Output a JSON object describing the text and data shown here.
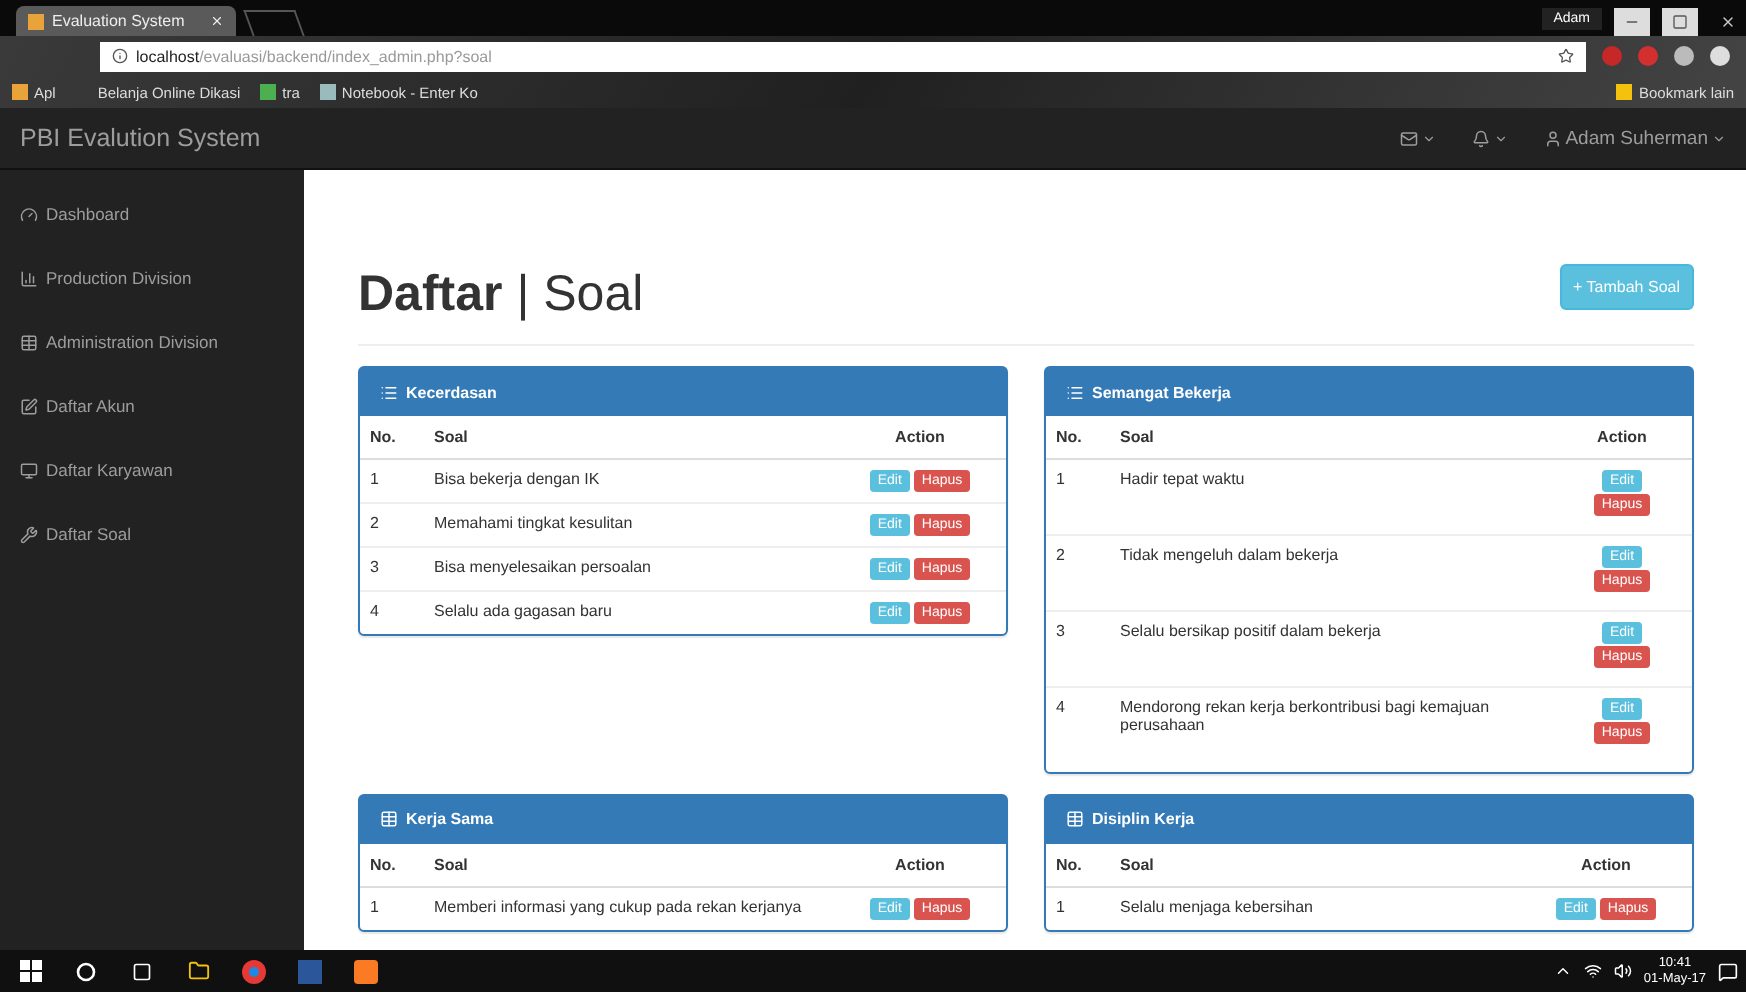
{
  "browser": {
    "tab_title": "Evaluation System",
    "url_host": "localhost",
    "url_path": "/evaluasi/backend/index_admin.php?soal",
    "bookmarks": [
      {
        "label": "Apl"
      },
      {
        "label": "Belanja Online Dikasi"
      },
      {
        "label": "tra"
      },
      {
        "label": "Notebook - Enter Ko"
      }
    ],
    "bookmark_folder": "Bookmark lain",
    "profile": "Adam"
  },
  "navbar": {
    "brand": "PBI Evalution System",
    "user": "Adam Suherman"
  },
  "sidebar": {
    "items": [
      {
        "label": "Dashboard"
      },
      {
        "label": "Production Division"
      },
      {
        "label": "Administration Division"
      },
      {
        "label": "Daftar Akun"
      },
      {
        "label": "Daftar Karyawan"
      },
      {
        "label": "Daftar Soal"
      }
    ]
  },
  "heading": "**Daftar** | Soal",
  "add_button": "+ Tambah Soal",
  "panels": [
    {
      "title": "Kecerdasan",
      "kind": "inline",
      "columns": [
        "No.",
        "Soal",
        "Action"
      ],
      "rows": [
        {
          "no": "1",
          "soal": "Bisa bekerja dengan IK",
          "edit": "Edit",
          "delete": "Hapus"
        },
        {
          "no": "2",
          "soal": "Memahami tingkat kesulitan",
          "edit": "Edit",
          "delete": "Hapus"
        },
        {
          "no": "3",
          "soal": "Bisa menyelesaikan persoalan",
          "edit": "Edit",
          "delete": "Hapus"
        },
        {
          "no": "4",
          "soal": "Selalu ada gagasan baru",
          "edit": "Edit",
          "delete": "Hapus"
        }
      ]
    },
    {
      "title": "Semangat Bekerja",
      "kind": "stacked",
      "columns": [
        "No.",
        "Soal",
        "Action"
      ],
      "rows": [
        {
          "no": "1",
          "soal": "Hadir tepat waktu",
          "edit": "Edit",
          "delete": "Hapus"
        },
        {
          "no": "2",
          "soal": "Tidak mengeluh dalam bekerja",
          "edit": "Edit",
          "delete": "Hapus"
        },
        {
          "no": "3",
          "soal": "Selalu bersikap positif dalam bekerja",
          "edit": "Edit",
          "delete": "Hapus"
        },
        {
          "no": "4",
          "soal": "Mendorong rekan kerja berkontribusi bagi kemajuan perusahaan",
          "edit": "Edit",
          "delete": "Hapus"
        }
      ]
    },
    {
      "title": "Kerja Sama",
      "kind": "inline",
      "columns": [
        "No.",
        "Soal",
        "Action"
      ],
      "rows": [
        {
          "no": "1",
          "soal": "Memberi informasi yang cukup pada rekan kerjanya",
          "edit": "Edit",
          "delete": "Hapus"
        }
      ]
    },
    {
      "title": "Disiplin Kerja",
      "kind": "inline",
      "columns": [
        "No.",
        "Soal",
        "Action"
      ],
      "rows": [
        {
          "no": "1",
          "soal": "Selalu menjaga kebersihan",
          "edit": "Edit",
          "delete": "Hapus"
        }
      ]
    }
  ],
  "taskbar": {
    "time": "10:41",
    "date": "01-May-17"
  }
}
